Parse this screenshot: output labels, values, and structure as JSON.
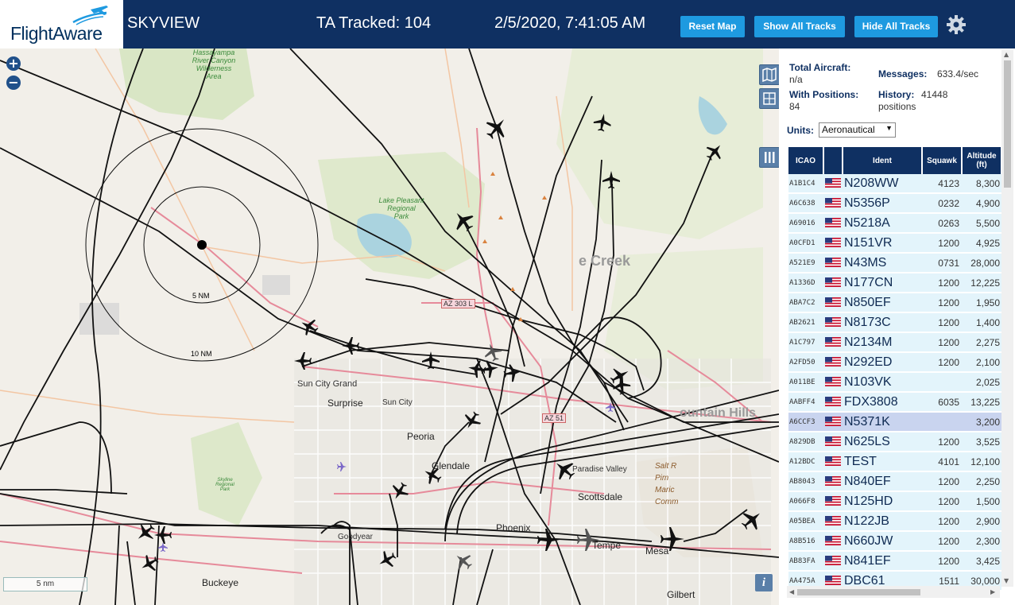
{
  "header": {
    "logo_text": "FlightAware",
    "app_title": "SKYVIEW",
    "tracked_label": "TA Tracked: 104",
    "timestamp": "2/5/2020, 7:41:05 AM",
    "buttons": {
      "reset_map": "Reset Map",
      "show_all_tracks": "Show All Tracks",
      "hide_all_tracks": "Hide All Tracks"
    },
    "settings_icon": "gear-icon",
    "colors": {
      "header_bg": "#0f3062",
      "button_bg": "#1e9ae0"
    }
  },
  "map": {
    "zoom_in": "+",
    "zoom_out": "−",
    "scale_label": "5 nm",
    "range_rings": [
      "5 NM",
      "10 NM"
    ],
    "info_button": "i",
    "places": {
      "sun_city_grand": "Sun City Grand",
      "surprise": "Surprise",
      "sun_city": "Sun City",
      "peoria": "Peoria",
      "glendale": "Glendale",
      "paradise_valley": "Paradise Valley",
      "scottsdale": "Scottsdale",
      "phoenix": "Phoenix",
      "tempe": "Tempe",
      "mesa": "Mesa",
      "buckeye": "Buckeye",
      "goodyear": "Goodyear",
      "gilbert": "Gilbert",
      "cave_creek": "e Creek",
      "fountain_hills": "ountain Hills",
      "salt_river": "Salt R\nPim\nMaric\nComm"
    },
    "parks": {
      "hassayampa": "Hassayampa\nRiver Canyon\nWilderness\nArea",
      "lake_pleasant": "Lake Pleasant\nRegional\nPark",
      "skyline": "Skyline\nRegional\nPark"
    },
    "shields": [
      "AZ 303 L",
      "AZ 51"
    ],
    "colors": {
      "track": "#111111",
      "ring": "#111111",
      "road": "#e68a9a",
      "park": "#cfe3b5",
      "water": "#aad3df"
    }
  },
  "sidebar": {
    "total_aircraft_label": "Total Aircraft:",
    "total_aircraft_value": "n/a",
    "with_positions_label": "With Positions:",
    "with_positions_value": "84",
    "messages_label": "Messages:",
    "messages_value": "633.4/sec",
    "history_label": "History:",
    "history_value": "41448",
    "history_unit": "positions",
    "units_label": "Units:",
    "units_value": "Aeronautical",
    "columns": [
      "ICAO",
      "",
      "Ident",
      "Squawk",
      "Altitude (ft)"
    ],
    "rows": [
      {
        "icao": "A1B1C4",
        "ident": "N208WW",
        "squawk": "4123",
        "alt": "8,300"
      },
      {
        "icao": "A6C638",
        "ident": "N5356P",
        "squawk": "0232",
        "alt": "4,900"
      },
      {
        "icao": "A69016",
        "ident": "N5218A",
        "squawk": "0263",
        "alt": "5,500"
      },
      {
        "icao": "A0CFD1",
        "ident": "N151VR",
        "squawk": "1200",
        "alt": "4,925"
      },
      {
        "icao": "A521E9",
        "ident": "N43MS",
        "squawk": "0731",
        "alt": "28,000"
      },
      {
        "icao": "A1336D",
        "ident": "N177CN",
        "squawk": "1200",
        "alt": "12,225"
      },
      {
        "icao": "ABA7C2",
        "ident": "N850EF",
        "squawk": "1200",
        "alt": "1,950"
      },
      {
        "icao": "AB2621",
        "ident": "N8173C",
        "squawk": "1200",
        "alt": "1,400"
      },
      {
        "icao": "A1C797",
        "ident": "N2134M",
        "squawk": "1200",
        "alt": "2,275"
      },
      {
        "icao": "A2FD50",
        "ident": "N292ED",
        "squawk": "1200",
        "alt": "2,100"
      },
      {
        "icao": "A011BE",
        "ident": "N103VK",
        "squawk": "",
        "alt": "2,025"
      },
      {
        "icao": "AABFF4",
        "ident": "FDX3808",
        "squawk": "6035",
        "alt": "13,225"
      },
      {
        "icao": "A6CCF3",
        "ident": "N5371K",
        "squawk": "",
        "alt": "3,200"
      },
      {
        "icao": "A829DB",
        "ident": "N625LS",
        "squawk": "1200",
        "alt": "3,525"
      },
      {
        "icao": "A12BDC",
        "ident": "TEST",
        "squawk": "4101",
        "alt": "12,100"
      },
      {
        "icao": "AB8043",
        "ident": "N840EF",
        "squawk": "1200",
        "alt": "2,250"
      },
      {
        "icao": "A066F8",
        "ident": "N125HD",
        "squawk": "1200",
        "alt": "1,500"
      },
      {
        "icao": "A05BEA",
        "ident": "N122JB",
        "squawk": "1200",
        "alt": "2,900"
      },
      {
        "icao": "A8B516",
        "ident": "N660JW",
        "squawk": "1200",
        "alt": "2,300"
      },
      {
        "icao": "AB83FA",
        "ident": "N841EF",
        "squawk": "1200",
        "alt": "3,425"
      },
      {
        "icao": "AA475A",
        "ident": "DBC61",
        "squawk": "1511",
        "alt": "30,000"
      }
    ],
    "selected_row_icao": "A6CCF3",
    "flag_icon": "us-flag-icon"
  }
}
